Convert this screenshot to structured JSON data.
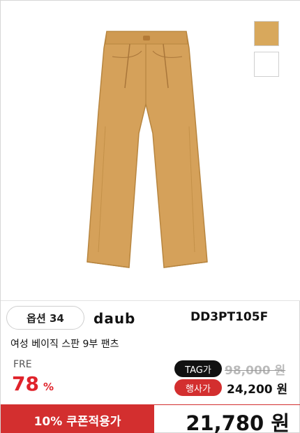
{
  "product": {
    "option_label": "옵션 34",
    "brand": "daub",
    "code": "DD3PT105F",
    "name": "여성 베이직 스판 9부 팬츠"
  },
  "swatches": [
    {
      "name": "camel",
      "color": "#d8a85c"
    },
    {
      "name": "white",
      "color": "#ffffff"
    }
  ],
  "pricing": {
    "size": "FRE",
    "discount_value": "78",
    "discount_unit": "%",
    "tag_label": "TAG가",
    "tag_price": "98,000 원",
    "event_label": "행사가",
    "event_price": "24,200 원",
    "coupon_label": "10% 쿠폰적용가",
    "final_price": "21,780 원"
  },
  "colors": {
    "pants": "#d5a15a",
    "accent_red": "#d32f2f",
    "discount_red": "#e0232b"
  }
}
